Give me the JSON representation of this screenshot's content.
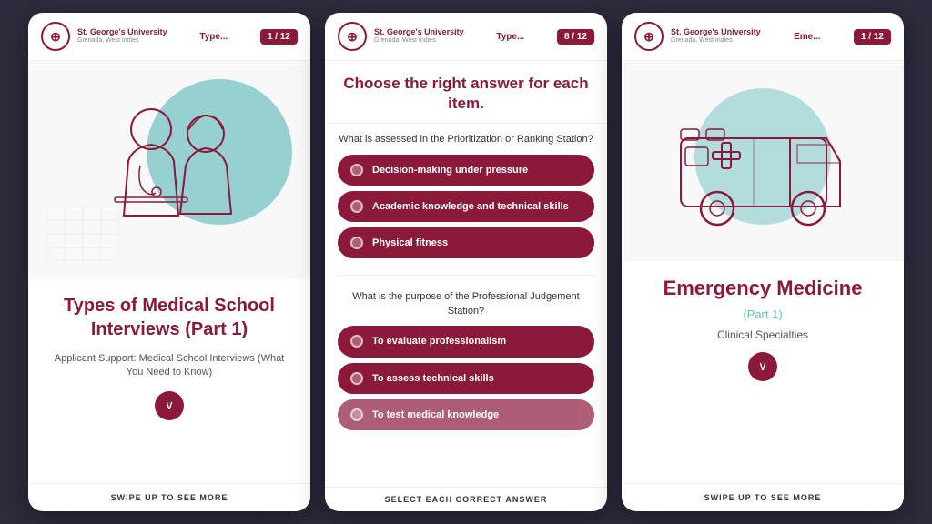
{
  "app": {
    "brand": {
      "name": "St. George's University",
      "location": "Grenada, West Indies",
      "logo_symbol": "⊕"
    }
  },
  "card1": {
    "header": {
      "type_label": "Type...",
      "counter": "1 / 12"
    },
    "title": "Types of Medical School Interviews (Part 1)",
    "subtitle": "Applicant Support: Medical School Interviews (What You Need to Know)",
    "chevron": "∨",
    "swipe_text": "SWIPE UP TO SEE MORE"
  },
  "card2": {
    "header": {
      "type_label": "Type...",
      "counter": "8 / 12"
    },
    "quiz_title": "Choose the right answer for each item.",
    "questions": [
      {
        "question": "What is assessed in the Prioritization or Ranking Station?",
        "answers": [
          "Decision-making under pressure",
          "Academic knowledge and technical skills",
          "Physical fitness"
        ]
      },
      {
        "question": "What is the purpose of the Professional Judgement Station?",
        "answers": [
          "To evaluate professionalism",
          "To assess technical skills",
          "To test medical knowledge"
        ]
      }
    ],
    "footer_text": "SELECT EACH CORRECT ANSWER"
  },
  "card3": {
    "header": {
      "type_label": "Eme...",
      "counter": "1 / 12"
    },
    "title": "Emergency Medicine",
    "part_label": "(Part 1)",
    "subtitle": "Clinical Specialties",
    "chevron": "∨",
    "swipe_text": "SWIPE UP TO SEE MORE"
  }
}
